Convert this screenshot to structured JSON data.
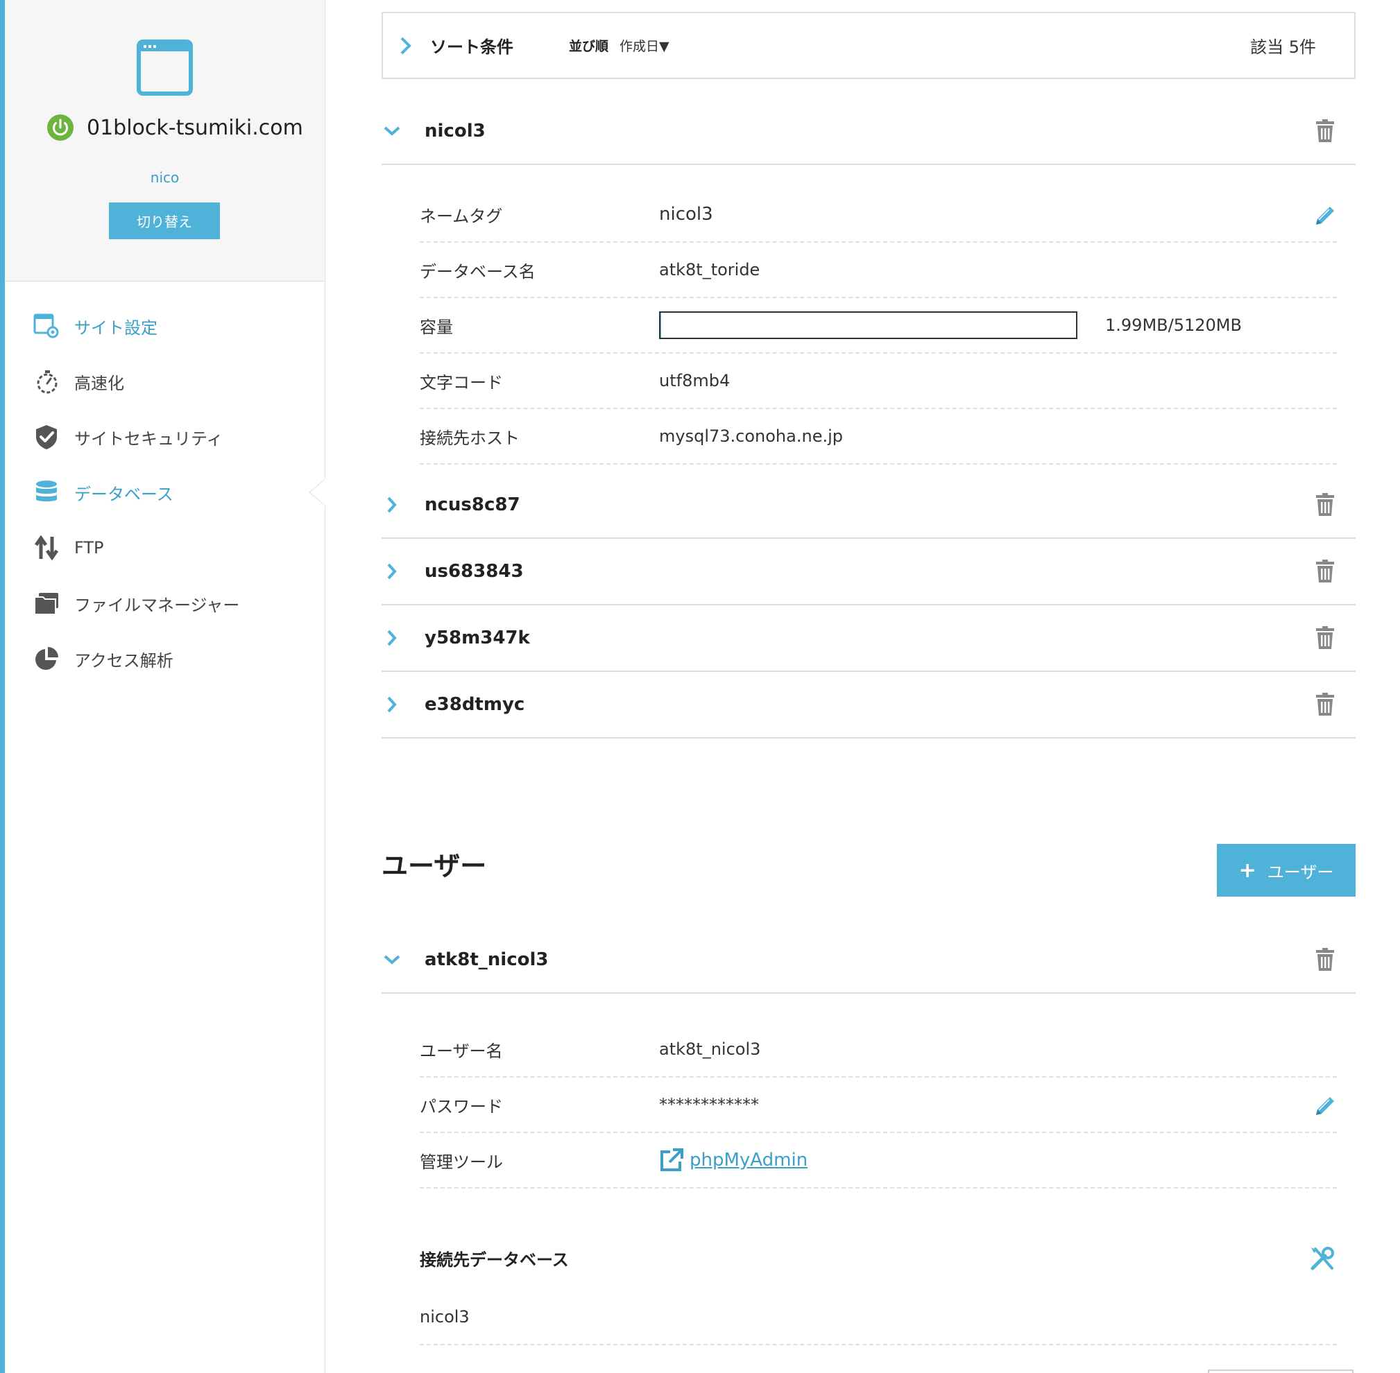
{
  "site": {
    "domain": "01block-tsumiki.com",
    "user": "nico",
    "switch_label": "切り替え"
  },
  "nav": {
    "items": [
      {
        "label": "サイト設定",
        "icon": "site-settings-icon"
      },
      {
        "label": "高速化",
        "icon": "stopwatch-icon"
      },
      {
        "label": "サイトセキュリティ",
        "icon": "shield-check-icon"
      },
      {
        "label": "データベース",
        "icon": "database-icon"
      },
      {
        "label": "FTP",
        "icon": "transfer-arrows-icon"
      },
      {
        "label": "ファイルマネージャー",
        "icon": "folder-icon"
      },
      {
        "label": "アクセス解析",
        "icon": "pie-chart-icon"
      }
    ],
    "active": "データベース"
  },
  "sort": {
    "title": "ソート条件",
    "order_label": "並び順",
    "order_value": "作成日▼",
    "count": "該当 5件"
  },
  "databases": {
    "expanded": {
      "name": "nicol3",
      "rows": {
        "nametag_label": "ネームタグ",
        "nametag_value": "nicol3",
        "dbname_label": "データベース名",
        "dbname_value": "atk8t_toride",
        "capacity_label": "容量",
        "capacity_text": "1.99MB/5120MB",
        "capacity_fraction": 0.0004,
        "charset_label": "文字コード",
        "charset_value": "utf8mb4",
        "host_label": "接続先ホスト",
        "host_value": "mysql73.conoha.ne.jp"
      }
    },
    "collapsed": [
      "ncus8c87",
      "us683843",
      "y58m347k",
      "e38dtmyc"
    ]
  },
  "users": {
    "title": "ユーザー",
    "add_label": "ユーザー",
    "expanded": {
      "name": "atk8t_nicol3",
      "username_label": "ユーザー名",
      "username_value": "atk8t_nicol3",
      "password_label": "パスワード",
      "password_value": "************",
      "tool_label": "管理ツール",
      "tool_link": "phpMyAdmin",
      "connected_db_title": "接続先データベース",
      "connected_db_value": "nicol3"
    }
  },
  "colors": {
    "accent": "#4fb3d9",
    "power_green": "#6cb33f",
    "icon_gray": "#555555"
  }
}
